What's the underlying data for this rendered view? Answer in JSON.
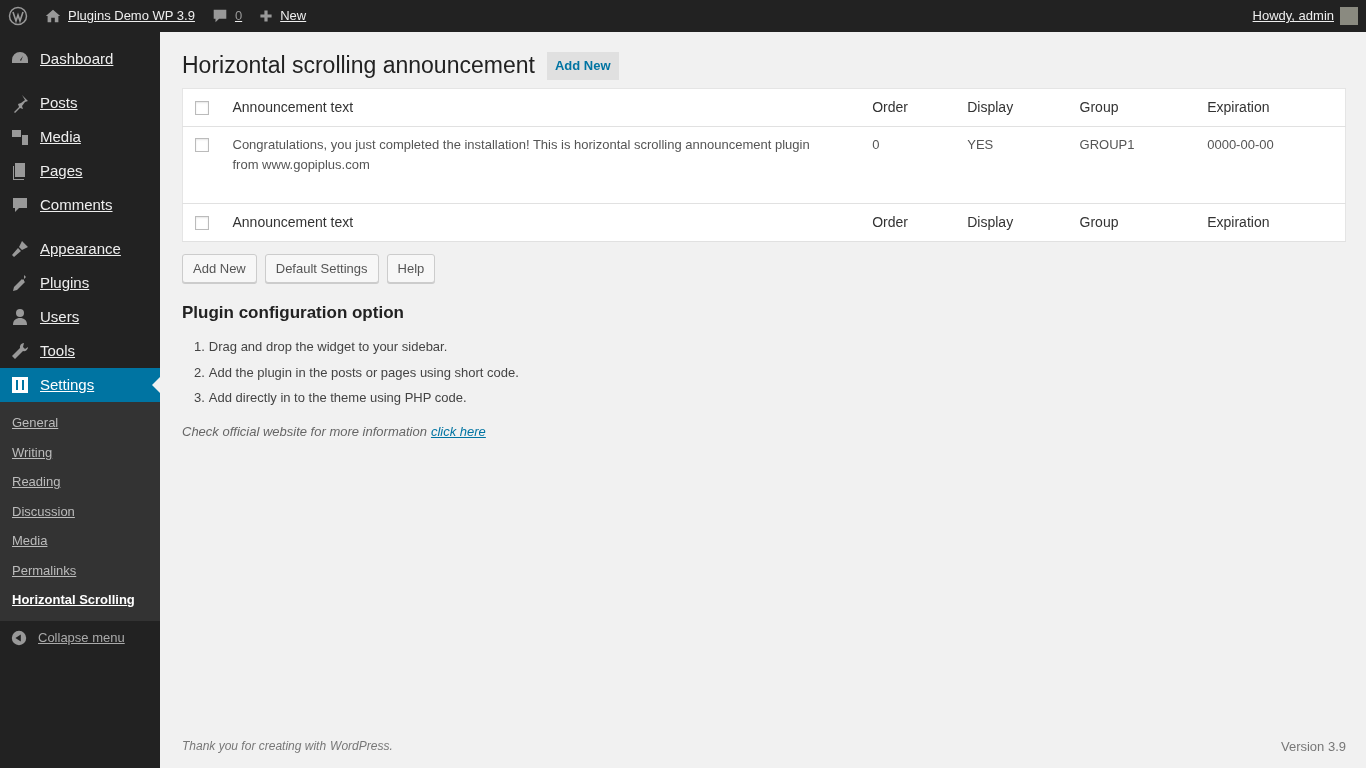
{
  "admin_bar": {
    "site_name": "Plugins Demo WP 3.9",
    "comments_count": "0",
    "new_label": "New",
    "greeting": "Howdy, admin"
  },
  "sidebar": {
    "groups": [
      [
        {
          "label": "Dashboard",
          "selected": false
        }
      ],
      [
        {
          "label": "Posts",
          "selected": false
        },
        {
          "label": "Media",
          "selected": false
        },
        {
          "label": "Pages",
          "selected": false
        },
        {
          "label": "Comments",
          "selected": false
        }
      ],
      [
        {
          "label": "Appearance",
          "selected": false
        },
        {
          "label": "Plugins",
          "selected": false
        },
        {
          "label": "Users",
          "selected": false
        },
        {
          "label": "Tools",
          "selected": false
        },
        {
          "label": "Settings",
          "selected": true,
          "children": [
            {
              "label": "General",
              "selected": false
            },
            {
              "label": "Writing",
              "selected": false
            },
            {
              "label": "Reading",
              "selected": false
            },
            {
              "label": "Discussion",
              "selected": false
            },
            {
              "label": "Media",
              "selected": false
            },
            {
              "label": "Permalinks",
              "selected": false
            },
            {
              "label": "Horizontal Scrolling",
              "selected": true
            }
          ]
        }
      ]
    ],
    "collapse_label": "Collapse menu"
  },
  "page": {
    "title": "Horizontal scrolling announcement",
    "title_action": "Add New"
  },
  "table": {
    "columns": [
      "Announcement text",
      "Order",
      "Display",
      "Group",
      "Expiration"
    ],
    "header_checked": false,
    "rows": [
      {
        "checked": false,
        "cells": [
          "Congratulations, you just completed the installation! This is horizontal scrolling announcement plugin from www.gopiplus.com",
          "0",
          "YES",
          "GROUP1",
          "0000-00-00"
        ]
      }
    ],
    "footer_columns": [
      "Announcement text",
      "Order",
      "Display",
      "Group",
      "Expiration"
    ],
    "footer_checked": false
  },
  "buttons": [
    "Add New",
    "Default Settings",
    "Help"
  ],
  "config": {
    "heading": "Plugin configuration option",
    "steps": [
      {
        "number": "1.",
        "text": "Drag and drop the widget to your sidebar."
      },
      {
        "number": "2.",
        "text": "Add the plugin in the posts or pages using short code."
      },
      {
        "number": "3.",
        "text": "Add directly in to the theme using PHP code."
      }
    ],
    "note": "Check official website for more information",
    "link": "click here"
  },
  "footer": {
    "text": "Thank you for creating with",
    "link": "WordPress.",
    "version": "Version 3.9"
  }
}
